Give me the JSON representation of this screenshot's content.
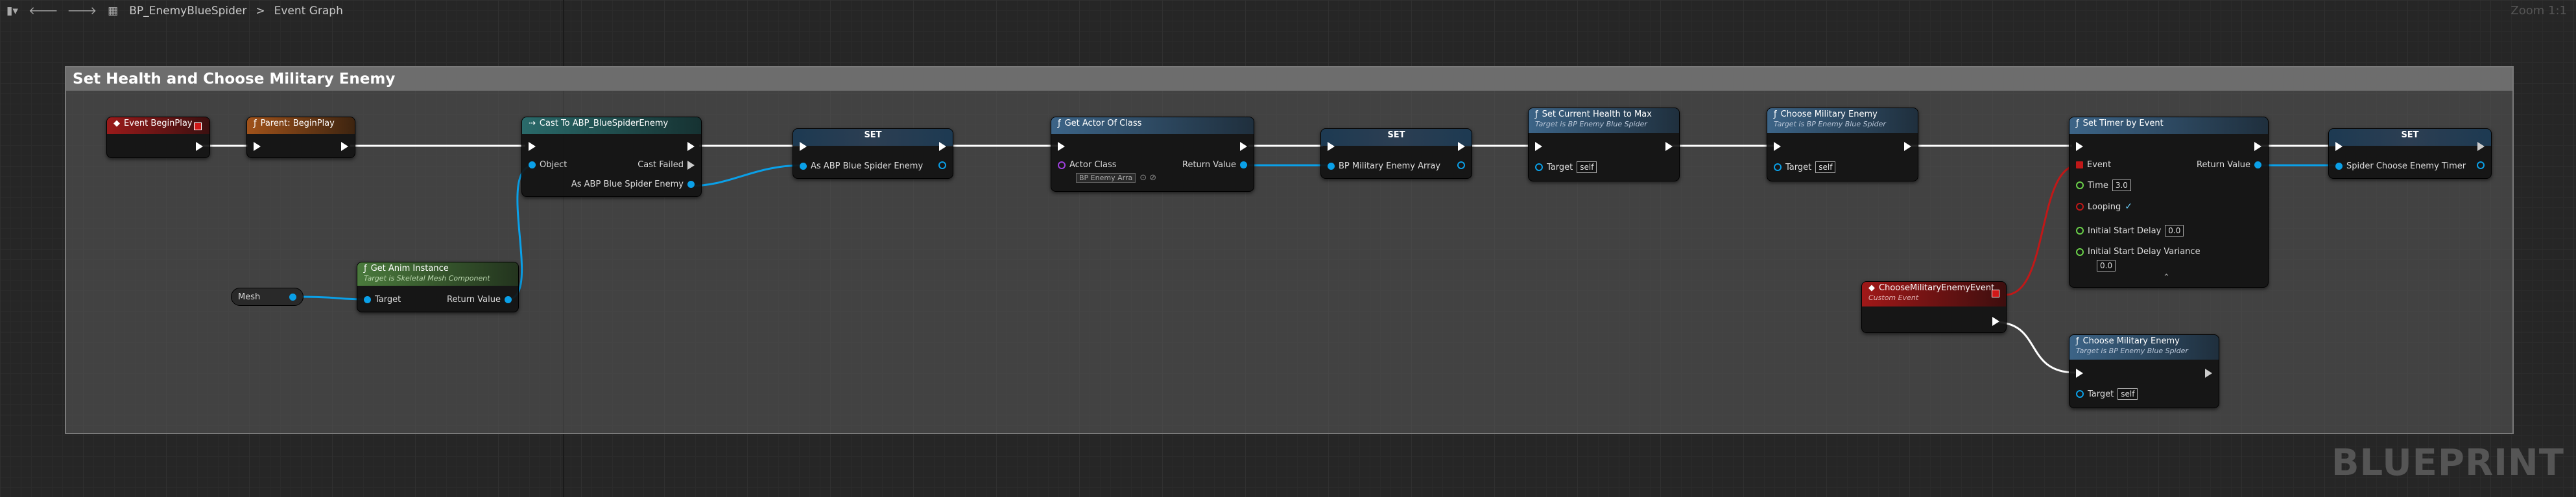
{
  "toolbar": {
    "back_arrow": "🡐",
    "fwd_arrow": "🡒",
    "asset": "BP_EnemyBlueSpider",
    "separator": ">",
    "graph": "Event Graph",
    "zoom": "Zoom 1:1"
  },
  "comment": {
    "title": "Set Health and Choose Military Enemy"
  },
  "watermark": "BLUEPRINT",
  "nodes": {
    "begin_play": {
      "title": "Event BeginPlay"
    },
    "parent_begin": {
      "title": "Parent: BeginPlay"
    },
    "cast": {
      "title": "Cast To ABP_BlueSpiderEnemy",
      "object": "Object",
      "cast_failed": "Cast Failed",
      "as_abp": "As ABP Blue Spider Enemy"
    },
    "set1": {
      "title": "SET",
      "as_abp": "As ABP Blue Spider Enemy"
    },
    "get_anim": {
      "title": "Get Anim Instance",
      "subtitle": "Target is Skeletal Mesh Component",
      "target": "Target",
      "return": "Return Value"
    },
    "mesh": {
      "label": "Mesh"
    },
    "get_actor": {
      "title": "Get Actor Of Class",
      "actor_class": "Actor Class",
      "dropdown": "BP Enemy Arra",
      "return": "Return Value"
    },
    "set2": {
      "title": "SET",
      "label": "BP Military Enemy Array"
    },
    "set_health": {
      "title": "Set Current Health to Max",
      "subtitle": "Target is BP Enemy Blue Spider",
      "target": "Target",
      "self": "self"
    },
    "choose1": {
      "title": "Choose Military Enemy",
      "subtitle": "Target is BP Enemy Blue Spider",
      "target": "Target",
      "self": "self"
    },
    "timer": {
      "title": "Set Timer by Event",
      "event": "Event",
      "return": "Return Value",
      "time": "Time",
      "time_val": "3.0",
      "looping": "Looping",
      "check": "✓",
      "isd": "Initial Start Delay",
      "isd_val": "0.0",
      "isdv": "Initial Start Delay Variance",
      "isdv_val": "0.0",
      "expand": "⌃"
    },
    "set3": {
      "title": "SET",
      "label": "Spider Choose Enemy Timer"
    },
    "custom": {
      "title": "ChooseMilitaryEnemyEvent",
      "subtitle": "Custom Event"
    },
    "choose2": {
      "title": "Choose Military Enemy",
      "subtitle": "Target is BP Enemy Blue Spider",
      "target": "Target",
      "self": "self"
    }
  },
  "icons": {
    "func": "ƒ",
    "event": "◆",
    "cast": "⇢"
  },
  "colors": {
    "exec": "#ffffff",
    "object": "#0aa0e8",
    "float": "#6bd14a",
    "event": "#c01818"
  }
}
